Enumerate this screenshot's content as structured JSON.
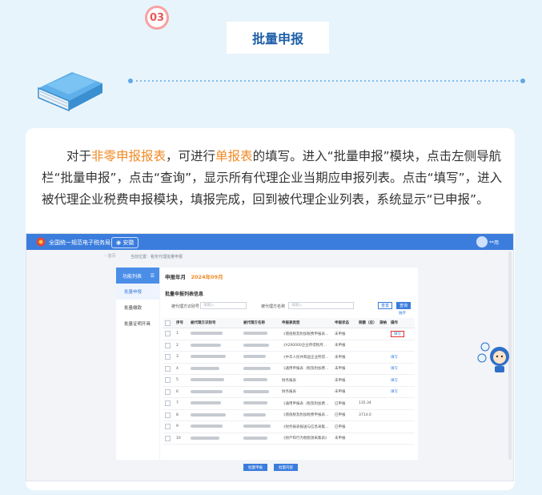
{
  "step": {
    "number": "03",
    "title": "批量申报"
  },
  "paragraph": {
    "p1": "对于",
    "h1": "非零申报报表",
    "p2": "，可进行",
    "h2": "单报表",
    "p3": "的填写。进入“批量申报”模块，点击左侧导航栏“批量申报”，点击“查询”，显示所有代理企业当期应申报列表。点击“填写”，进入被代理企业税费申报模块，填报完成，回到被代理企业列表，系统显示“已申报”。"
  },
  "screenshot": {
    "topbar": {
      "site_name": "全国统一规范电子税务局",
      "region": "安徽",
      "user": "**用"
    },
    "breadcrumb_home": "首页",
    "breadcrumb": "当前位置：税务代理批量申报",
    "sidebar": {
      "header": "功能列表",
      "items": [
        {
          "label": "批量申报",
          "active": true
        },
        {
          "label": "批量缴款",
          "active": false
        },
        {
          "label": "批量证明开具",
          "active": false
        }
      ]
    },
    "period_label": "申报年月",
    "period_value": "2024年09月",
    "list_title": "批量申报列表信息",
    "filter": {
      "tax_id_label": "被代理方识别号",
      "tax_id_placeholder": "请输入",
      "name_label": "被代理方名称",
      "name_placeholder": "请输入",
      "reset": "重置",
      "query": "查询",
      "expand": "展开"
    },
    "columns": [
      "序号",
      "被代理方识别号",
      "被代理方名称",
      "申报表类型",
      "申报状态",
      "税额（应）",
      "滞纳",
      "操作"
    ],
    "rows": [
      {
        "no": "1",
        "type": "《增值税及附加税费申报表…",
        "status": "未申报",
        "tax": "",
        "op": "填写",
        "highlight": true
      },
      {
        "no": "2",
        "type": "《A200000企业所得税月…",
        "status": "未申报",
        "tax": "",
        "op": "",
        "highlight": false
      },
      {
        "no": "3",
        "type": "《中华人民共和国企业所得…",
        "status": "未申报",
        "tax": "",
        "op": "填写",
        "highlight": false
      },
      {
        "no": "4",
        "type": "《通用申报表（税及附加费…",
        "status": "未申报",
        "tax": "",
        "op": "填写",
        "highlight": false
      },
      {
        "no": "5",
        "type": "财务报表",
        "status": "未申报",
        "tax": "",
        "op": "填写",
        "highlight": false
      },
      {
        "no": "6",
        "type": "财务报表",
        "status": "未申报",
        "tax": "",
        "op": "填写",
        "highlight": false
      },
      {
        "no": "7",
        "type": "《通用申报表（税及附加费…",
        "status": "已申报",
        "tax": "135.34",
        "op": "",
        "highlight": false
      },
      {
        "no": "8",
        "type": "《增值税及附加税费申报表…",
        "status": "已申报",
        "tax": "3714.0",
        "op": "",
        "highlight": false
      },
      {
        "no": "9",
        "type": "《财务报表报送与信息采集…",
        "status": "已申报",
        "tax": "",
        "op": "",
        "highlight": false
      },
      {
        "no": "10",
        "type": "《财产和行为税税源采集表》",
        "status": "未申报",
        "tax": "",
        "op": "",
        "highlight": false
      }
    ],
    "bottom_buttons": {
      "batch_declare": "批量申报",
      "batch_content": "批量内容"
    }
  },
  "colors": {
    "accent": "#3b7ddd",
    "highlight": "#f08a27",
    "title": "#1f5fa8",
    "red": "#e03030"
  }
}
